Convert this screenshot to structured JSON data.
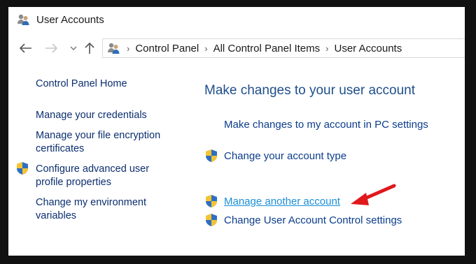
{
  "window": {
    "title": "User Accounts",
    "app_icon": "user-accounts-icon"
  },
  "nav": {
    "back_icon": "back-arrow-icon",
    "forward_icon": "forward-arrow-icon",
    "recent_icon": "chevron-down-icon",
    "up_icon": "up-arrow-icon",
    "breadcrumb": [
      "Control Panel",
      "All Control Panel Items",
      "User Accounts"
    ],
    "separator": "›"
  },
  "sidebar": {
    "home": "Control Panel Home",
    "items": [
      {
        "label_lines": [
          "Manage your credentials"
        ],
        "shield": false
      },
      {
        "label_lines": [
          "Manage your file encryption",
          "certificates"
        ],
        "shield": false
      },
      {
        "label_lines": [
          "Configure advanced user",
          "profile properties"
        ],
        "shield": true
      },
      {
        "label_lines": [
          "Change my environment",
          "variables"
        ],
        "shield": false
      }
    ]
  },
  "main": {
    "heading": "Make changes to your user account",
    "links": [
      {
        "label": "Make changes to my account in PC settings",
        "shield": false
      },
      {
        "label": "Change your account type",
        "shield": true
      },
      {
        "label": "Manage another account",
        "shield": true,
        "hover": true
      },
      {
        "label": "Change User Account Control settings",
        "shield": true
      }
    ]
  },
  "colors": {
    "link": "#0b3c8c",
    "link_hover": "#1a8fd8",
    "heading": "#1e4e8c",
    "annotation_arrow": "#e0191c"
  }
}
